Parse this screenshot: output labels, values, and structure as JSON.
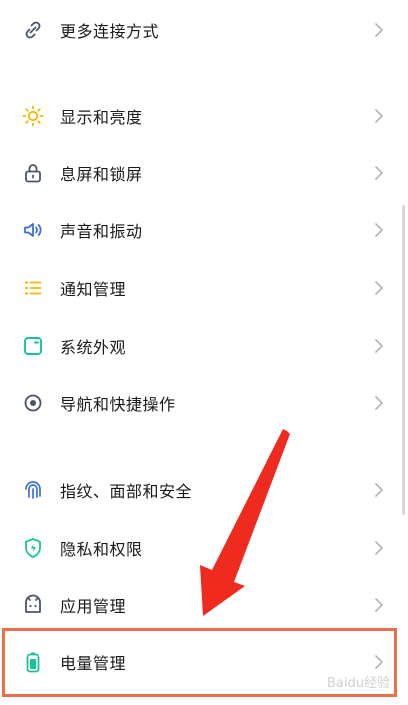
{
  "settings": {
    "items": [
      {
        "label": "更多连接方式",
        "icon": "link-icon"
      },
      {
        "label": "显示和亮度",
        "icon": "sun-icon"
      },
      {
        "label": "息屏和锁屏",
        "icon": "lock-icon"
      },
      {
        "label": "声音和振动",
        "icon": "speaker-icon"
      },
      {
        "label": "通知管理",
        "icon": "list-icon"
      },
      {
        "label": "系统外观",
        "icon": "theme-icon"
      },
      {
        "label": "导航和快捷操作",
        "icon": "navigation-icon"
      },
      {
        "label": "指纹、面部和安全",
        "icon": "fingerprint-icon"
      },
      {
        "label": "隐私和权限",
        "icon": "shield-icon"
      },
      {
        "label": "应用管理",
        "icon": "app-icon"
      },
      {
        "label": "电量管理",
        "icon": "battery-icon"
      }
    ]
  },
  "colors": {
    "accent_yellow": "#f5b800",
    "accent_green": "#19c29a",
    "accent_blue": "#3a6fd8",
    "icon_gray": "#4a5566",
    "annotation_red": "#ec6e4a",
    "arrow_red": "#ef2a1f"
  },
  "watermark": "Baidu经验"
}
